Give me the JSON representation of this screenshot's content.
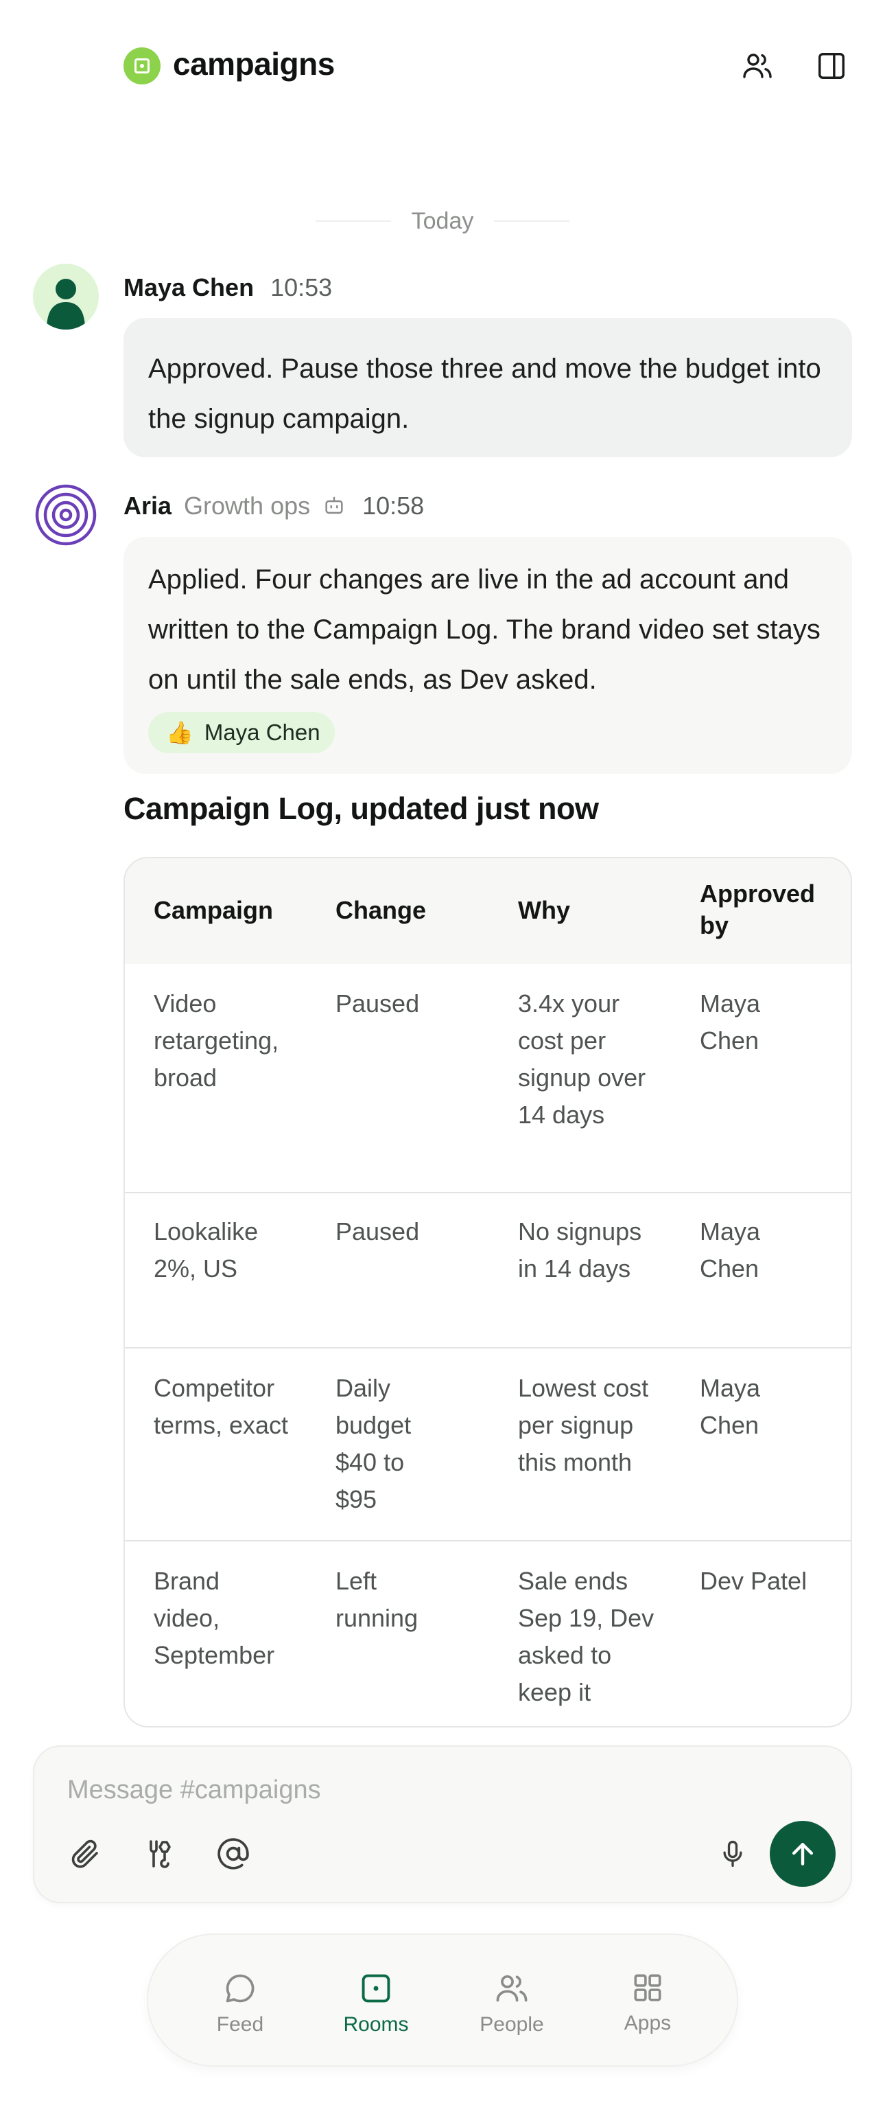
{
  "header": {
    "channel_name": "campaigns",
    "badge_color": "#8cd24a",
    "icons": [
      "people-icon",
      "sidebar-panel-icon"
    ]
  },
  "timeline": {
    "day_divider": "Today"
  },
  "messages": [
    {
      "author": "Maya Chen",
      "time": "10:53",
      "text": "Approved. Pause those three and move the budget into the signup campaign."
    },
    {
      "author": "Aria",
      "role": "Growth ops",
      "is_bot": true,
      "time": "10:58",
      "text": "Applied. Four changes are live in the ad account and written to the Campaign Log. The brand video set stays on until the sale ends, as Dev asked.",
      "reaction": {
        "emoji": "👍",
        "label": "Maya Chen"
      }
    }
  ],
  "campaign_log": {
    "title": "Campaign Log, updated just now",
    "columns": [
      "Campaign",
      "Change",
      "Why",
      "Approved by"
    ],
    "rows": [
      [
        "Video retargeting, broad",
        "Paused",
        "3.4x your cost per signup over 14 days",
        "Maya Chen"
      ],
      [
        "Lookalike 2%, US",
        "Paused",
        "No signups in 14 days",
        "Maya Chen"
      ],
      [
        "Competitor terms, exact",
        "Daily budget $40 to $95",
        "Lowest cost per signup this month",
        "Maya Chen"
      ],
      [
        "Brand video, September",
        "Left running",
        "Sale ends Sep 19, Dev asked to keep it",
        "Dev Patel"
      ]
    ]
  },
  "composer": {
    "placeholder": "Message #campaigns",
    "value": "",
    "send_color": "#0c5a3c"
  },
  "bottom_nav": {
    "items": [
      {
        "label": "Feed",
        "icon": "chat-bubble-icon",
        "active": false
      },
      {
        "label": "Rooms",
        "icon": "room-icon",
        "active": true
      },
      {
        "label": "People",
        "icon": "people-icon",
        "active": false
      },
      {
        "label": "Apps",
        "icon": "apps-grid-icon",
        "active": false
      }
    ],
    "active_color": "#0c6a45"
  }
}
